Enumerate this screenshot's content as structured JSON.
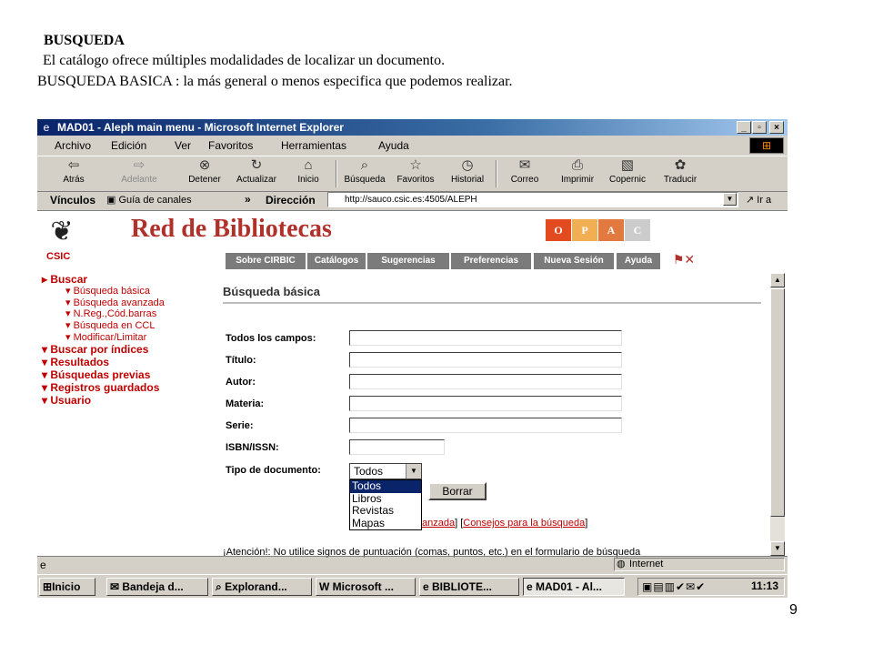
{
  "slide": {
    "title": "BUSQUEDA",
    "subtitle": "El catálogo ofrece  múltiples modalidades de localizar un documento.",
    "subtitle2": "BUSQUEDA BASICA : la más general o menos especifica que podemos realizar.",
    "page_number": "9"
  },
  "window": {
    "title": "MAD01 - Aleph main menu - Microsoft Internet Explorer"
  },
  "menu": [
    "Archivo",
    "Edición",
    "Ver",
    "Favoritos",
    "Herramientas",
    "Ayuda"
  ],
  "toolbar": {
    "back": "Atrás",
    "forward": "Adelante",
    "stop": "Detener",
    "refresh": "Actualizar",
    "home": "Inicio",
    "search": "Búsqueda",
    "favorites": "Favoritos",
    "history": "Historial",
    "mail": "Correo",
    "print": "Imprimir",
    "copernic": "Copernic",
    "translate": "Traducir"
  },
  "address": {
    "links_label": "Vínculos",
    "channel_guide": "Guía de canales",
    "chevron": "»",
    "label": "Dirección",
    "url": "http://sauco.csic.es:4505/ALEPH",
    "go": "Ir a"
  },
  "page": {
    "csic": "CSIC",
    "title": "Red de Bibliotecas",
    "opac": [
      "O",
      "P",
      "A",
      "C"
    ],
    "opac_colors": [
      "#e24a1f",
      "#f2ae52",
      "#e27a3f",
      "#cccccc"
    ],
    "nav_tabs": [
      "Sobre CIRBIC",
      "Catálogos",
      "Sugerencias",
      "Preferencias",
      "Nueva Sesión",
      "Ayuda"
    ],
    "sidebar": {
      "buscar": "Buscar",
      "sub": [
        "Búsqueda básica",
        "Búsqueda avanzada",
        "N.Reg.,Cód.barras",
        "Búsqueda en CCL",
        "Modificar/Limitar"
      ],
      "main": [
        "Buscar por índices",
        "Resultados",
        "Búsquedas previas",
        "Registros guardados",
        "Usuario"
      ]
    },
    "heading": "Búsqueda básica",
    "fields": [
      "Todos los campos:",
      "Título:",
      "Autor:",
      "Materia:",
      "Serie:",
      "ISBN/ISSN:"
    ],
    "doc_type_label": "Tipo de documento:",
    "doc_type_value": "Todos",
    "doc_type_options": [
      "Todos",
      "Libros",
      "Revistas",
      "Mapas"
    ],
    "clear_button": "Borrar",
    "link_avanzada": "anzada",
    "link_sep": "] [",
    "link_consejos": "Consejos para la búsqueda",
    "link_end": "]",
    "attention": "¡Atención!: No utilice signos de puntuación (comas, puntos, etc.) en el formulario de búsqueda"
  },
  "status": {
    "zone": "Internet"
  },
  "taskbar": {
    "start": "Inicio",
    "buttons": [
      "Bandeja d...",
      "Explorand...",
      "Microsoft ...",
      "BIBLIOTE...",
      "MAD01 - Al..."
    ],
    "clock": "11:13"
  }
}
